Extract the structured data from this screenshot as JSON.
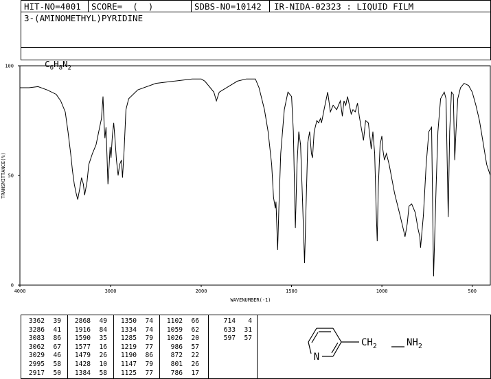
{
  "header": {
    "hit_no": "HIT-NO=4001",
    "score": "SCORE=  (  )",
    "sdbs_no": "SDBS-NO=10142",
    "ir_id": "IR-NIDA-02323 : LIQUID FILM"
  },
  "compound": {
    "name": "3-(AMINOMETHYL)PYRIDINE",
    "formula": {
      "c": "C",
      "c_n": "6",
      "h": "H",
      "h_n": "8",
      "n": "N",
      "n_n": "2"
    }
  },
  "structure": {
    "ring_atom": "N",
    "chain": "CH",
    "chain_sub": "2",
    "amine": "NH",
    "amine_sub": "2"
  },
  "chart_data": {
    "type": "line",
    "xlabel": "WAVENUMBER(-1)",
    "ylabel": "TRANSMITTANCE(%)",
    "xlim": [
      4000,
      400
    ],
    "ylim": [
      0,
      100
    ],
    "x_ticks": [
      "4000",
      "3000",
      "2000",
      "1500",
      "1000",
      "500"
    ],
    "y_ticks": [
      "100",
      "50",
      "0"
    ],
    "grid": false,
    "points": [
      [
        4000,
        90
      ],
      [
        3900,
        90
      ],
      [
        3800,
        90.5
      ],
      [
        3700,
        89
      ],
      [
        3600,
        87
      ],
      [
        3550,
        84
      ],
      [
        3500,
        79
      ],
      [
        3470,
        70
      ],
      [
        3440,
        60
      ],
      [
        3420,
        52
      ],
      [
        3400,
        46
      ],
      [
        3380,
        42
      ],
      [
        3362,
        39
      ],
      [
        3340,
        44
      ],
      [
        3320,
        49
      ],
      [
        3300,
        46
      ],
      [
        3286,
        41
      ],
      [
        3260,
        47
      ],
      [
        3240,
        55
      ],
      [
        3200,
        60
      ],
      [
        3160,
        64
      ],
      [
        3130,
        70
      ],
      [
        3100,
        76
      ],
      [
        3083,
        86
      ],
      [
        3070,
        72
      ],
      [
        3062,
        67
      ],
      [
        3050,
        72
      ],
      [
        3040,
        60
      ],
      [
        3029,
        46
      ],
      [
        3015,
        55
      ],
      [
        3005,
        63
      ],
      [
        2995,
        58
      ],
      [
        2980,
        68
      ],
      [
        2965,
        74
      ],
      [
        2950,
        66
      ],
      [
        2935,
        57
      ],
      [
        2917,
        50
      ],
      [
        2900,
        55
      ],
      [
        2880,
        57
      ],
      [
        2868,
        49
      ],
      [
        2850,
        62
      ],
      [
        2830,
        80
      ],
      [
        2800,
        85
      ],
      [
        2700,
        89
      ],
      [
        2500,
        92
      ],
      [
        2300,
        93
      ],
      [
        2100,
        94
      ],
      [
        2000,
        94
      ],
      [
        1980,
        93
      ],
      [
        1950,
        90
      ],
      [
        1930,
        88
      ],
      [
        1916,
        84
      ],
      [
        1900,
        88
      ],
      [
        1880,
        89
      ],
      [
        1800,
        93
      ],
      [
        1750,
        94
      ],
      [
        1700,
        94
      ],
      [
        1680,
        90
      ],
      [
        1650,
        80
      ],
      [
        1630,
        70
      ],
      [
        1610,
        55
      ],
      [
        1600,
        40
      ],
      [
        1590,
        35
      ],
      [
        1586,
        38
      ],
      [
        1577,
        16
      ],
      [
        1570,
        35
      ],
      [
        1560,
        60
      ],
      [
        1540,
        80
      ],
      [
        1520,
        88
      ],
      [
        1500,
        86
      ],
      [
        1490,
        70
      ],
      [
        1479,
        26
      ],
      [
        1470,
        55
      ],
      [
        1460,
        70
      ],
      [
        1450,
        64
      ],
      [
        1440,
        40
      ],
      [
        1428,
        10
      ],
      [
        1420,
        35
      ],
      [
        1410,
        65
      ],
      [
        1400,
        70
      ],
      [
        1390,
        60
      ],
      [
        1384,
        58
      ],
      [
        1375,
        70
      ],
      [
        1360,
        75
      ],
      [
        1350,
        74
      ],
      [
        1340,
        76
      ],
      [
        1334,
        74
      ],
      [
        1320,
        80
      ],
      [
        1300,
        88
      ],
      [
        1285,
        79
      ],
      [
        1270,
        82
      ],
      [
        1250,
        80
      ],
      [
        1230,
        84
      ],
      [
        1219,
        77
      ],
      [
        1210,
        84
      ],
      [
        1200,
        82
      ],
      [
        1190,
        86
      ],
      [
        1180,
        82
      ],
      [
        1170,
        78
      ],
      [
        1160,
        80
      ],
      [
        1147,
        79
      ],
      [
        1135,
        83
      ],
      [
        1125,
        77
      ],
      [
        1115,
        72
      ],
      [
        1102,
        66
      ],
      [
        1090,
        75
      ],
      [
        1075,
        74
      ],
      [
        1059,
        62
      ],
      [
        1050,
        70
      ],
      [
        1040,
        60
      ],
      [
        1030,
        30
      ],
      [
        1026,
        20
      ],
      [
        1020,
        45
      ],
      [
        1010,
        64
      ],
      [
        1000,
        68
      ],
      [
        995,
        62
      ],
      [
        986,
        57
      ],
      [
        975,
        60
      ],
      [
        960,
        55
      ],
      [
        930,
        42
      ],
      [
        900,
        32
      ],
      [
        880,
        25
      ],
      [
        872,
        22
      ],
      [
        860,
        28
      ],
      [
        850,
        36
      ],
      [
        835,
        37
      ],
      [
        815,
        33
      ],
      [
        801,
        26
      ],
      [
        790,
        22
      ],
      [
        786,
        17
      ],
      [
        770,
        32
      ],
      [
        755,
        55
      ],
      [
        740,
        70
      ],
      [
        725,
        72
      ],
      [
        714,
        4
      ],
      [
        700,
        45
      ],
      [
        690,
        70
      ],
      [
        675,
        85
      ],
      [
        655,
        88
      ],
      [
        645,
        85
      ],
      [
        633,
        31
      ],
      [
        625,
        70
      ],
      [
        615,
        88
      ],
      [
        605,
        87
      ],
      [
        597,
        57
      ],
      [
        590,
        70
      ],
      [
        580,
        85
      ],
      [
        565,
        90
      ],
      [
        545,
        92
      ],
      [
        520,
        91
      ],
      [
        500,
        88
      ],
      [
        480,
        82
      ],
      [
        460,
        75
      ],
      [
        440,
        65
      ],
      [
        420,
        55
      ],
      [
        400,
        50
      ]
    ],
    "peak_table": [
      [
        "3362",
        "39"
      ],
      [
        "3286",
        "41"
      ],
      [
        "3083",
        "86"
      ],
      [
        "3062",
        "67"
      ],
      [
        "3029",
        "46"
      ],
      [
        "2995",
        "58"
      ],
      [
        "2917",
        "50"
      ],
      [
        "2868",
        "49"
      ],
      [
        "1916",
        "84"
      ],
      [
        "1590",
        "35"
      ],
      [
        "1577",
        "16"
      ],
      [
        "1479",
        "26"
      ],
      [
        "1428",
        "10"
      ],
      [
        "1384",
        "58"
      ],
      [
        "1350",
        "74"
      ],
      [
        "1334",
        "74"
      ],
      [
        "1285",
        "79"
      ],
      [
        "1219",
        "77"
      ],
      [
        "1190",
        "86"
      ],
      [
        "1147",
        "79"
      ],
      [
        "1125",
        "77"
      ],
      [
        "1102",
        "66"
      ],
      [
        "1059",
        "62"
      ],
      [
        "1026",
        "20"
      ],
      [
        "986",
        "57"
      ],
      [
        "872",
        "22"
      ],
      [
        "801",
        "26"
      ],
      [
        "786",
        "17"
      ],
      [
        "714",
        "4"
      ],
      [
        "633",
        "31"
      ],
      [
        "597",
        "57"
      ]
    ]
  }
}
